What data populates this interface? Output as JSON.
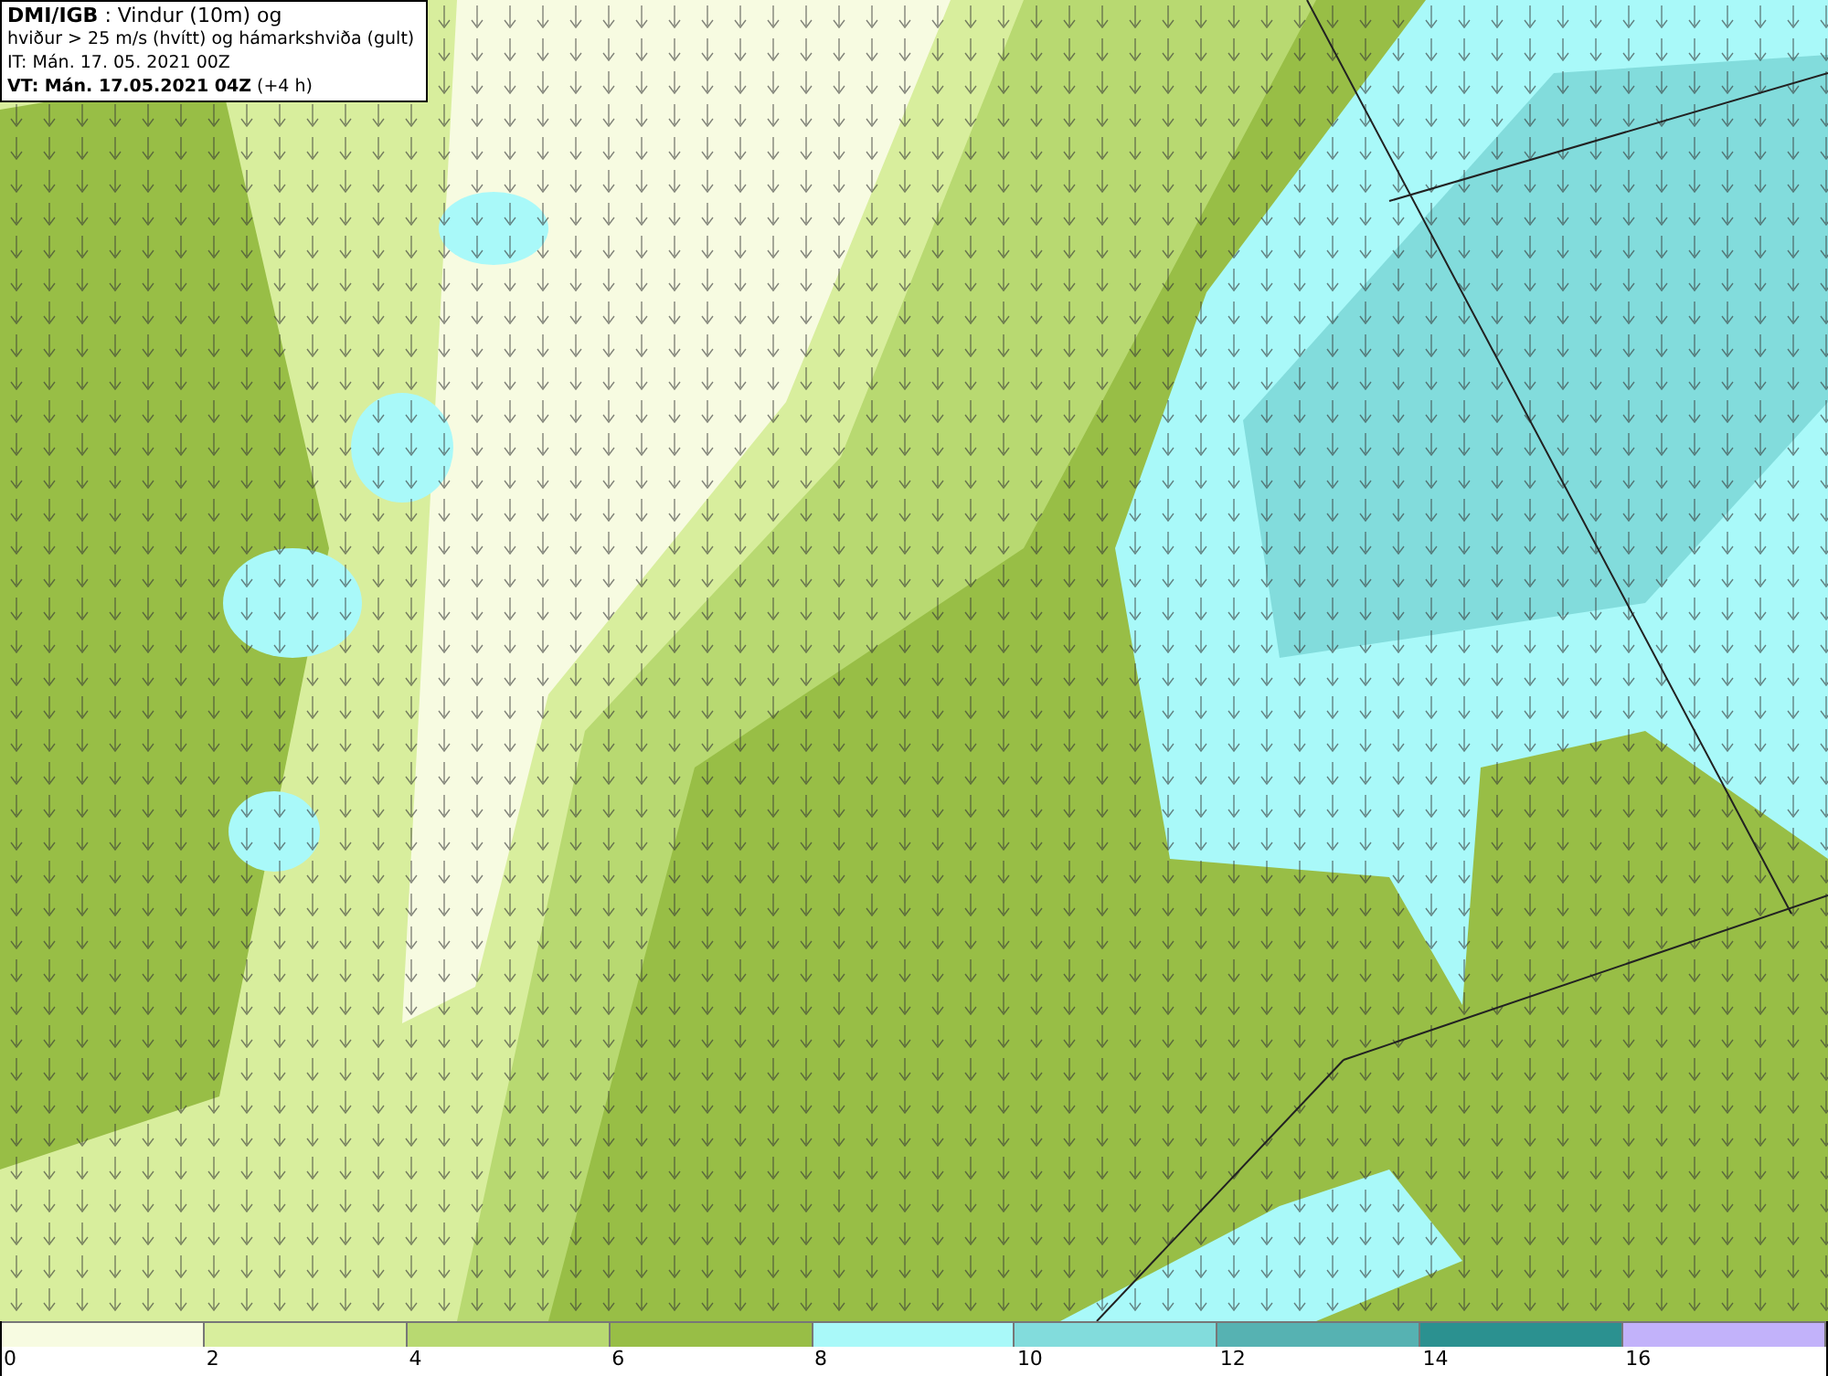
{
  "header": {
    "lines": [
      "**DMI/IGB** : Vindur (10m) og",
      "hviður > 25 m/s (hvítt) og hámarkshviða (gult)",
      "IT: Mán. 17. 05. 2021 00Z",
      "**VT: Mán. 17.05.2021 04Z** (+4 h)"
    ]
  },
  "legend": {
    "bins": [
      {
        "color": "#f7fbe1",
        "label": "0"
      },
      {
        "color": "#d8ee9d",
        "label": "2"
      },
      {
        "color": "#b8d971",
        "label": "4"
      },
      {
        "color": "#98be46",
        "label": "6"
      },
      {
        "color": "#a9f9f9",
        "label": "8"
      },
      {
        "color": "#82dcdc",
        "label": "10"
      },
      {
        "color": "#56b2b2",
        "label": "12"
      },
      {
        "color": "#2b9190",
        "label": "14"
      },
      {
        "color": "#c2b2fa",
        "label": "16"
      }
    ]
  }
}
